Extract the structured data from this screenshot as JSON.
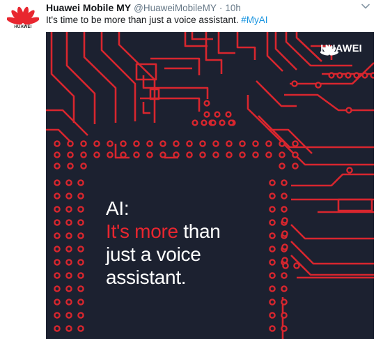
{
  "colors": {
    "brand_red": "#e8262f",
    "hashtag_blue": "#1b95e0",
    "handle_gray": "#657786",
    "board_dark": "#1c2130",
    "trace_red": "#d8262e"
  },
  "avatar": {
    "icon": "huawei-logo-icon",
    "wordmark": "HUAWEI"
  },
  "tweet": {
    "display_name": "Huawei Mobile MY",
    "handle": "@HuaweiMobileMY",
    "separator": "·",
    "timestamp": "10h",
    "text": "It's time to be more than just a voice assistant.",
    "hashtag": "#MyAI",
    "menu_icon": "chevron-down-icon"
  },
  "media": {
    "logo_text": "HUAWEI",
    "headline": {
      "line1": "AI:",
      "line2_accent": "It's more",
      "line2_rest": " than",
      "line3": "just a voice",
      "line4": "assistant."
    }
  }
}
